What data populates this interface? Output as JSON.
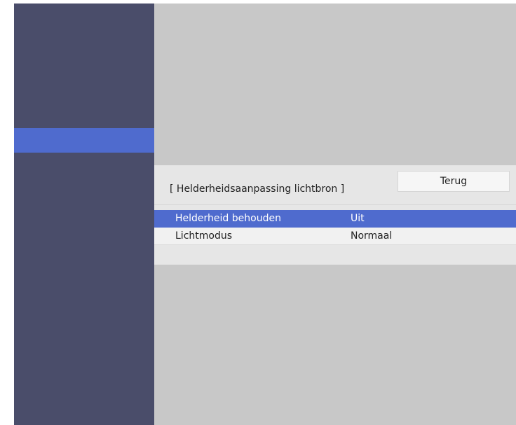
{
  "panel": {
    "title": "[ Helderheidsaanpassing lichtbron ]",
    "back_label": "Terug"
  },
  "menu": {
    "items": [
      {
        "label": "Helderheid behouden",
        "value": "Uit",
        "selected": true
      },
      {
        "label": "Lichtmodus",
        "value": "Normaal",
        "selected": false
      }
    ]
  },
  "colors": {
    "sidebar": "#4a4d6a",
    "highlight": "#4f6bce",
    "background": "#c8c8c8",
    "panel": "#e6e6e6"
  }
}
